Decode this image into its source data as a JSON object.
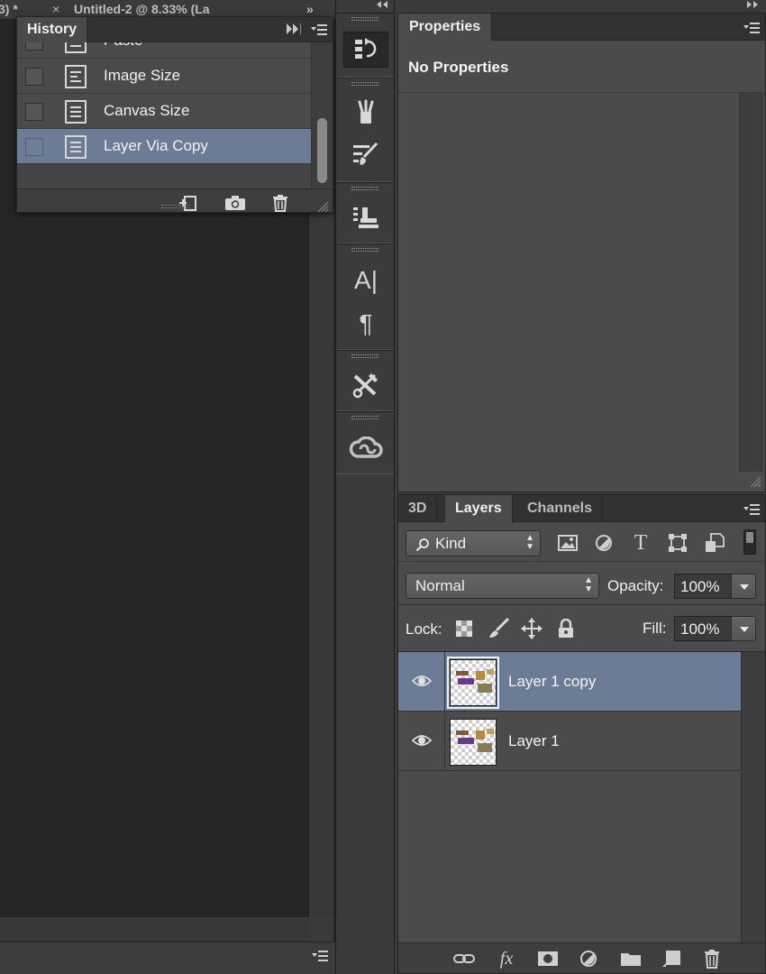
{
  "document": {
    "tab_fragments": [
      "3) *",
      "×",
      "Untitled-2 @ 8.33% (La",
      "»"
    ]
  },
  "history": {
    "title": "History",
    "items": [
      {
        "label": "Paste",
        "selected": false
      },
      {
        "label": "Image Size",
        "selected": false
      },
      {
        "label": "Canvas Size",
        "selected": false
      },
      {
        "label": "Layer Via Copy",
        "selected": true
      }
    ],
    "footer_icons": [
      "new-document-from-state-icon",
      "camera-icon",
      "trash-icon"
    ]
  },
  "tools": {
    "groups": [
      [
        "history-panel-icon"
      ],
      [
        "brushes-icon",
        "brush-presets-icon"
      ],
      [
        "clone-source-icon"
      ],
      [
        "character-icon",
        "paragraph-icon"
      ],
      [
        "tool-presets-icon"
      ],
      [
        "creative-cloud-icon"
      ]
    ],
    "character_glyph": "A|",
    "paragraph_glyph": "¶"
  },
  "properties": {
    "tab_label": "Properties",
    "title": "No Properties"
  },
  "layers_panel": {
    "tabs": [
      {
        "label": "3D",
        "active": false
      },
      {
        "label": "Layers",
        "active": true
      },
      {
        "label": "Channels",
        "active": false
      }
    ],
    "filter_kind": "Kind",
    "filter_icons": [
      "image-filter-icon",
      "adjustment-filter-icon",
      "type-filter-icon",
      "shape-filter-icon",
      "smart-object-filter-icon"
    ],
    "type_glyph": "T",
    "blend_mode": "Normal",
    "opacity_label": "Opacity:",
    "opacity_value": "100%",
    "lock_label": "Lock:",
    "lock_icons": [
      "lock-transparent-pixels-icon",
      "lock-image-pixels-icon",
      "lock-position-icon",
      "lock-all-icon"
    ],
    "fill_label": "Fill:",
    "fill_value": "100%",
    "layers": [
      {
        "name": "Layer 1 copy",
        "visible": true,
        "selected": true
      },
      {
        "name": "Layer 1",
        "visible": true,
        "selected": false
      }
    ],
    "footer_icons": [
      "link-layers-icon",
      "fx-icon",
      "add-mask-icon",
      "adjustment-layer-icon",
      "group-folder-icon",
      "new-layer-icon",
      "delete-layer-icon"
    ],
    "fx_glyph": "fx"
  },
  "colors": {
    "selection": "#6c7c96",
    "panel_bg": "#4b4b4b",
    "header_bg": "#323232"
  }
}
